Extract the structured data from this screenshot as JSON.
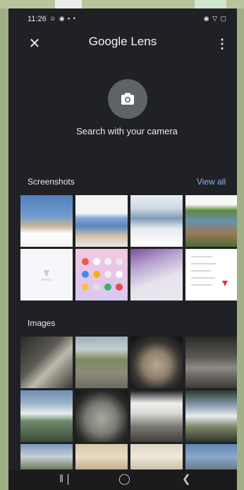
{
  "status_bar": {
    "time": "11:26",
    "left_icons": "☺ ◉ ▪ •",
    "right_icons": "◉ ▽ ▢"
  },
  "app_bar": {
    "title_google": "Google",
    "title_lens": "Lens",
    "close_icon": "close-icon",
    "more_icon": "more-vert-icon"
  },
  "camera": {
    "label": "Search with your camera",
    "icon": "camera-icon"
  },
  "sections": {
    "screenshots": {
      "title": "Screenshots",
      "view_all": "View all"
    },
    "images": {
      "title": "Images"
    }
  },
  "navigation": {
    "recents_icon": "recents-icon",
    "home_icon": "home-icon",
    "back_icon": "back-icon"
  },
  "colors": {
    "background": "#202124",
    "accent": "#8ab4f8",
    "camera_circle": "#5f6368"
  }
}
